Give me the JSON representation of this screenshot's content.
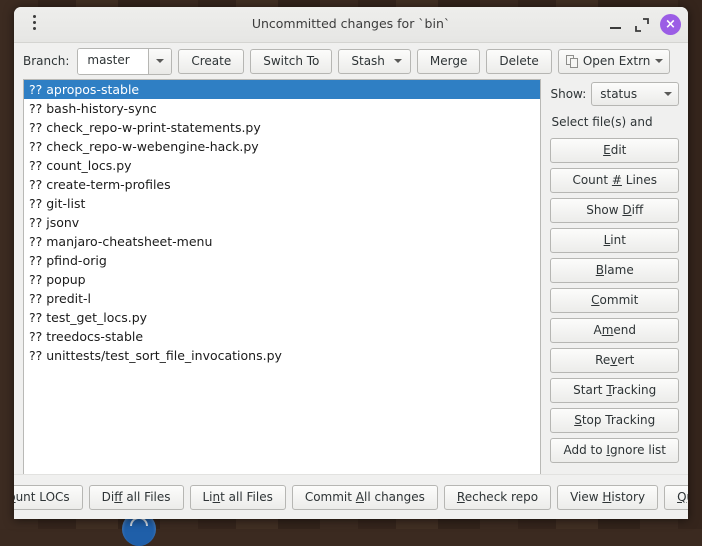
{
  "window": {
    "title": "Uncommitted changes for `bin`",
    "menu_icon": "three-dots-vertical-icon",
    "minimize_label": "",
    "maximize_label": "",
    "close_label": "×"
  },
  "toolbar": {
    "branch_label": "Branch:",
    "branch_value": "master",
    "buttons": [
      {
        "label": "Create",
        "name": "create-button"
      },
      {
        "label": "Switch To",
        "name": "switch-to-button"
      },
      {
        "label": "Stash",
        "name": "stash-button",
        "has_arrow": true
      },
      {
        "label": "Merge",
        "name": "merge-button"
      },
      {
        "label": "Delete",
        "name": "delete-button"
      }
    ],
    "open_extrn_label": "Open Extrn",
    "open_extrn_icon": "copy-windows-icon"
  },
  "filelist": {
    "selected_index": 0,
    "items": [
      "?? apropos-stable",
      "?? bash-history-sync",
      "?? check_repo-w-print-statements.py",
      "?? check_repo-w-webengine-hack.py",
      "?? count_locs.py",
      "?? create-term-profiles",
      "?? git-list",
      "?? jsonv",
      "?? manjaro-cheatsheet-menu",
      "?? pfind-orig",
      "?? popup",
      "?? predit-l",
      "?? test_get_locs.py",
      "?? treedocs-stable",
      "?? unittests/test_sort_file_invocations.py"
    ]
  },
  "sidepanel": {
    "show_label": "Show:",
    "show_value": "status",
    "hint": "Select file(s) and",
    "buttons": [
      {
        "label": "Edit",
        "accel": "E",
        "name": "edit-button"
      },
      {
        "label": "Count # Lines",
        "accel": "#",
        "name": "count-lines-button"
      },
      {
        "label": "Show Diff",
        "accel": "D",
        "name": "show-diff-button"
      },
      {
        "label": "Lint",
        "accel": "L",
        "name": "lint-button"
      },
      {
        "label": "Blame",
        "accel": "B",
        "name": "blame-button"
      },
      {
        "label": "Commit",
        "accel": "C",
        "name": "commit-button"
      },
      {
        "label": "Amend",
        "accel": "m",
        "name": "amend-button"
      },
      {
        "label": "Revert",
        "accel": "v",
        "name": "revert-button"
      },
      {
        "label": "Start Tracking",
        "accel": "T",
        "name": "start-tracking-button"
      },
      {
        "label": "Stop Tracking",
        "accel": "S",
        "name": "stop-tracking-button"
      },
      {
        "label": "Add to Ignore list",
        "accel": "I",
        "name": "add-to-ignore-list-button"
      }
    ]
  },
  "bottombar": {
    "buttons": [
      {
        "label": "Count LOCs",
        "accel": "o",
        "name": "count-locs-button"
      },
      {
        "label": "Diff all Files",
        "accel": "f",
        "name": "diff-all-files-button"
      },
      {
        "label": "Lint all Files",
        "accel": "n",
        "name": "lint-all-files-button"
      },
      {
        "label": "Commit All changes",
        "accel": "A",
        "name": "commit-all-changes-button"
      },
      {
        "label": "Recheck repo",
        "accel": "R",
        "name": "recheck-repo-button"
      },
      {
        "label": "View History",
        "accel": "H",
        "name": "view-history-button"
      },
      {
        "label": "Quit",
        "accel": "Q",
        "name": "quit-button"
      }
    ]
  },
  "colors": {
    "selection": "#2f7fc4",
    "close_button": "#9b5de5",
    "desktop": "#3c2b21",
    "dock_icon": "#1f5fa9"
  }
}
